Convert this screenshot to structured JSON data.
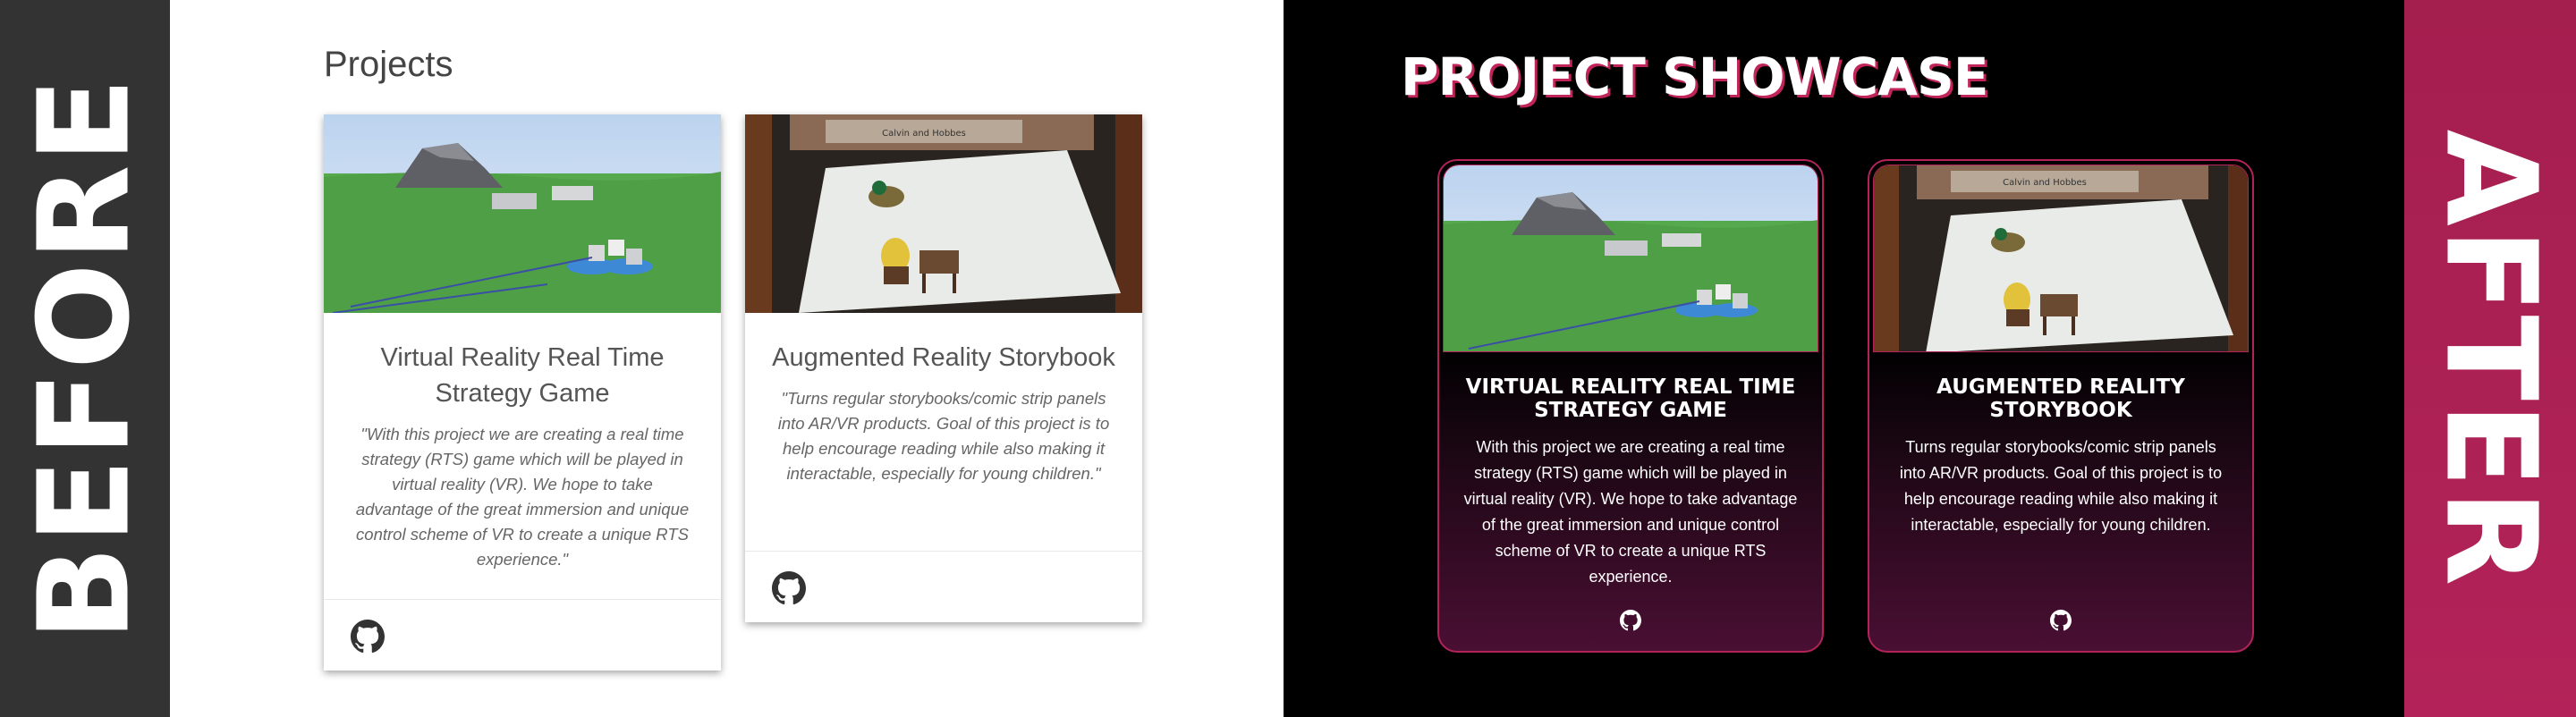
{
  "labels": {
    "before": "BEFORE",
    "after": "AFTER"
  },
  "before": {
    "title": "Projects",
    "cards": [
      {
        "title": "Virtual Reality Real Time Strategy Game",
        "description": "\"With this project we are creating a real time strategy (RTS) game which will be played in virtual reality (VR). We hope to take advantage of the great immersion and unique control scheme of VR to create a unique RTS experience.\"",
        "icon": "github-icon"
      },
      {
        "title": "Augmented Reality Storybook",
        "description": "\"Turns regular storybooks/comic strip panels into AR/VR products. Goal of this project is to help encourage reading while also making it interactable, especially for young children.\"",
        "icon": "github-icon"
      }
    ]
  },
  "after": {
    "title": "PROJECT SHOWCASE",
    "cards": [
      {
        "title": "VIRTUAL REALITY REAL TIME STRATEGY GAME",
        "description": "With this project we are creating a real time strategy (RTS) game which will be played in virtual reality (VR). We hope to take advantage of the great immersion and unique control scheme of VR to create a unique RTS experience.",
        "icon": "github-icon"
      },
      {
        "title": "AUGMENTED REALITY STORYBOOK",
        "description": "Turns regular storybooks/comic strip panels into AR/VR products. Goal of this project is to help encourage reading while also making it interactable, especially for young children.",
        "icon": "github-icon"
      }
    ]
  },
  "images": {
    "storybook_sign": "Calvin and Hobbes"
  },
  "colors": {
    "before_bar": "#333333",
    "after_bar": "#a41e4e",
    "accent": "#b32359",
    "after_bg": "#000000"
  }
}
